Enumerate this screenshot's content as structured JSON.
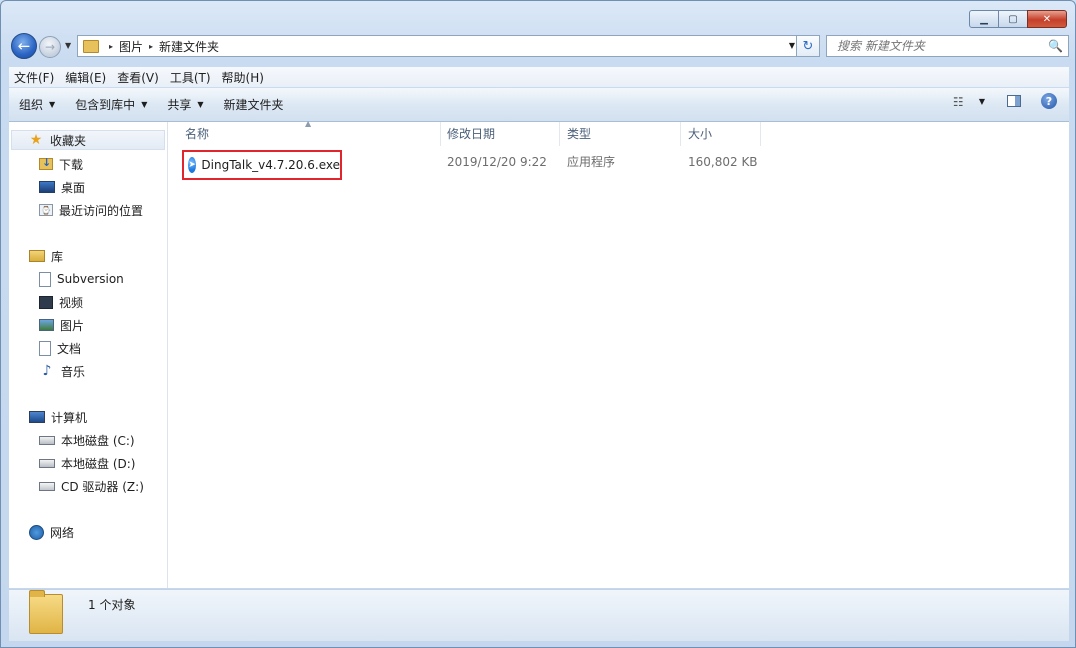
{
  "window": {
    "caption": {
      "minimize": "▁",
      "maximize": "▢",
      "close": "✕"
    }
  },
  "address": {
    "segments": [
      "图片",
      "新建文件夹"
    ],
    "separator": "▸"
  },
  "search": {
    "placeholder": "搜索 新建文件夹"
  },
  "menu": [
    "文件(F)",
    "编辑(E)",
    "查看(V)",
    "工具(T)",
    "帮助(H)"
  ],
  "toolbar": {
    "organize": "组织",
    "include_library": "包含到库中",
    "share": "共享",
    "new_folder": "新建文件夹",
    "help": "?"
  },
  "navpane": {
    "favorites": {
      "label": "收藏夹",
      "items": [
        "下载",
        "桌面",
        "最近访问的位置"
      ]
    },
    "libraries": {
      "label": "库",
      "items": [
        "Subversion",
        "视频",
        "图片",
        "文档",
        "音乐"
      ]
    },
    "computer": {
      "label": "计算机",
      "items": [
        "本地磁盘 (C:)",
        "本地磁盘 (D:)",
        "CD 驱动器 (Z:)"
      ]
    },
    "network": {
      "label": "网络"
    }
  },
  "columns": [
    "名称",
    "修改日期",
    "类型",
    "大小"
  ],
  "files": [
    {
      "name": "DingTalk_v4.7.20.6.exe",
      "modified": "2019/12/20 9:22",
      "type": "应用程序",
      "size": "160,802 KB"
    }
  ],
  "status": {
    "count_text": "1 个对象"
  },
  "colors": {
    "highlight_border": "#e0262c",
    "accent": "#2a64c4"
  }
}
